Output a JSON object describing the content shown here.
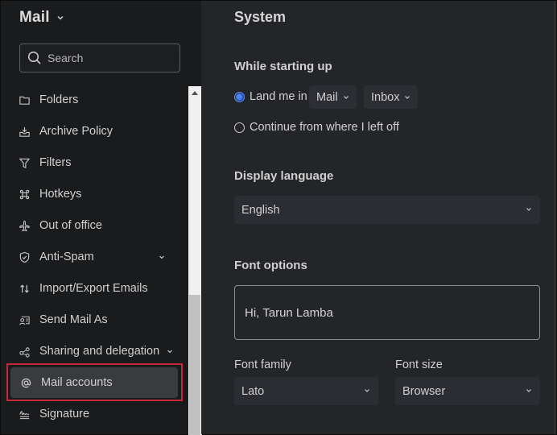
{
  "sidebar": {
    "app_title": "Mail",
    "search": {
      "placeholder": "Search",
      "value": ""
    },
    "items": [
      {
        "label": "Folders",
        "icon": "folder-icon",
        "expandable": false
      },
      {
        "label": "Archive Policy",
        "icon": "archive-icon",
        "expandable": false
      },
      {
        "label": "Filters",
        "icon": "filter-icon",
        "expandable": false
      },
      {
        "label": "Hotkeys",
        "icon": "command-icon",
        "expandable": false
      },
      {
        "label": "Out of office",
        "icon": "airplane-icon",
        "expandable": false
      },
      {
        "label": "Anti-Spam",
        "icon": "shield-check-icon",
        "expandable": true
      },
      {
        "label": "Import/Export Emails",
        "icon": "import-export-icon",
        "expandable": false
      },
      {
        "label": "Send Mail As",
        "icon": "contact-card-icon",
        "expandable": false
      },
      {
        "label": "Sharing and delegation",
        "icon": "share-icon",
        "expandable": true
      },
      {
        "label": "Mail accounts",
        "icon": "at-icon",
        "expandable": false,
        "active": true
      },
      {
        "label": "Signature",
        "icon": "signature-icon",
        "expandable": false
      }
    ],
    "highlight_color": "#c4283a"
  },
  "main": {
    "title": "System",
    "startup": {
      "heading": "While starting up",
      "option_land": "Land me in",
      "land_app": "Mail",
      "land_folder": "Inbox",
      "option_continue": "Continue from where I left off",
      "selected": "land"
    },
    "language": {
      "heading": "Display language",
      "value": "English"
    },
    "font": {
      "heading": "Font options",
      "preview_text": "Hi, Tarun Lamba",
      "family_label": "Font family",
      "family_value": "Lato",
      "size_label": "Font size",
      "size_value": "Browser"
    }
  },
  "colors": {
    "accent": "#4f86f7",
    "sidebar_bg": "#1a1b1d",
    "main_bg": "#242528"
  }
}
